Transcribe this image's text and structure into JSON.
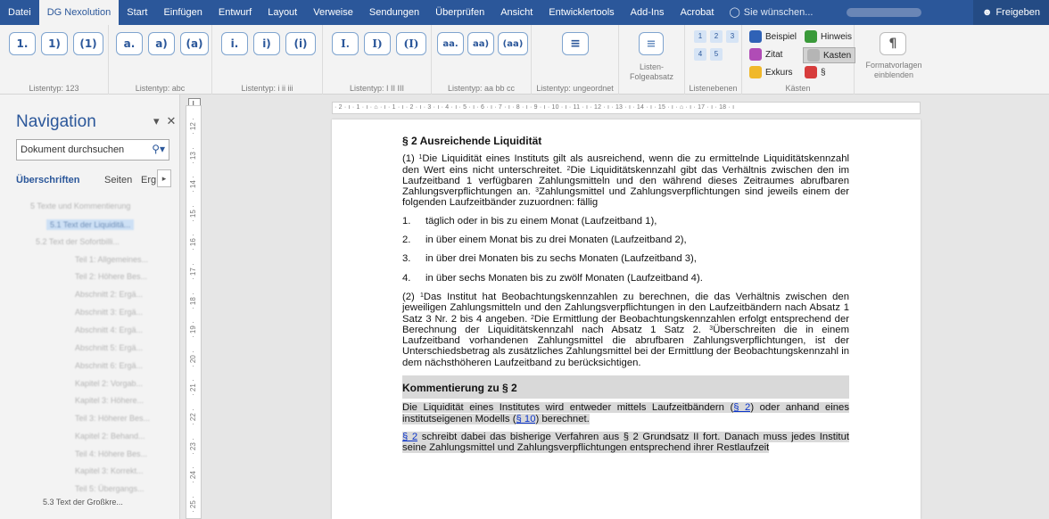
{
  "tabs": [
    "Datei",
    "DG Nexolution",
    "Start",
    "Einfügen",
    "Entwurf",
    "Layout",
    "Verweise",
    "Sendungen",
    "Überprüfen",
    "Ansicht",
    "Entwicklertools",
    "Add-Ins",
    "Acrobat"
  ],
  "tell_me": "Sie wünschen...",
  "share_label": "Freigeben",
  "ribbon": {
    "group_labels": [
      "Listentyp: 123",
      "Listentyp: abc",
      "Listentyp: i ii iii",
      "Listentyp: I II III",
      "Listentyp: aa bb cc",
      "Listentyp: ungeordnet",
      "Listen-\nFolgeabsatz",
      "Listenebenen",
      "Kästen",
      "Formatvorlagen\neinblenden"
    ],
    "btn_123": [
      "1.",
      "1)",
      "(1)"
    ],
    "btn_abc": [
      "a.",
      "a)",
      "(a)"
    ],
    "btn_roman_lower": [
      "i.",
      "i)",
      "(i)"
    ],
    "btn_roman_upper": [
      "I.",
      "I)",
      "(I)"
    ],
    "btn_aa": [
      "aa.",
      "aa)",
      "(aa)"
    ],
    "levels": [
      "1",
      "2",
      "3",
      "4",
      "5"
    ],
    "kasten": [
      "Beispiel",
      "Hinweis",
      "Zitat",
      "Kasten",
      "Exkurs",
      "§"
    ]
  },
  "nav": {
    "title": "Navigation",
    "search_placeholder": "Dokument durchsuchen",
    "tabs": [
      "Überschriften",
      "Seiten",
      "Erg"
    ],
    "items": [
      "5 Texte und Kommentierung",
      "5.1 Text der Liquiditä...",
      "5.2 Text der Sofortbilli...",
      "Teil 1: Allgemeines...",
      "Teil 2: Höhere Bes...",
      "Abschnitt 2: Ergä...",
      "Abschnitt 3: Ergä...",
      "Abschnitt 4: Ergä...",
      "Abschnitt 5: Ergä...",
      "Abschnitt 6: Ergä...",
      "Kapitel 2: Vorgab...",
      "Kapitel 3: Höhere...",
      "Teil 3: Höherer Bes...",
      "Kapitel 2: Behand...",
      "Teil 4: Höhere Bes...",
      "Kapitel 3: Korrekt...",
      "Teil 5: Übergangs..."
    ],
    "last_item": "5.3 Text der Großkre..."
  },
  "hruler": "· 2 · ı · 1 · ı · ⌂ · ı · 1 · ı · 2 · ı · 3 · ı · 4 · ı · 5 · ı · 6 · ı · 7 · ı · 8 · ı · 9 · ı · 10 · ı · 11 · ı · 12 · ı · 13 · ı · 14 · ı · 15 · ı · ⌂ · ı · 17 · ı · 18 · ı",
  "vruler": [
    "12",
    "13",
    "14",
    "15",
    "16",
    "17",
    "18",
    "19",
    "20",
    "21",
    "22",
    "23",
    "24",
    "25"
  ],
  "document": {
    "heading": "§ 2 Ausreichende Liquidität",
    "p1_a": "(1) ",
    "p1_b": "Die Liquidität eines Instituts gilt als ausreichend, wenn die zu ermittelnde Liquiditätskennzahl den Wert eins nicht unterschreitet. ",
    "p1_c": "Die Liquiditätskennzahl gibt das Verhältnis zwischen den im Laufzeitband 1 verfügbaren Zahlungsmitteln und den während dieses Zeitraumes abrufbaren Zahlungsverpflichtungen an. ",
    "p1_d": "Zahlungsmittel und Zahlungsverpflichtungen sind jeweils einem der folgenden Laufzeitbänder zuzuordnen: fällig",
    "list": [
      {
        "num": "1.",
        "text": "täglich oder in bis zu einem Monat (Laufzeitband 1),"
      },
      {
        "num": "2.",
        "text": "in über einem Monat bis zu drei Monaten (Laufzeitband 2),"
      },
      {
        "num": "3.",
        "text": "in über drei Monaten bis zu sechs Monaten (Laufzeitband 3),"
      },
      {
        "num": "4.",
        "text": "in über sechs Monaten bis zu zwölf Monaten (Laufzeitband 4)."
      }
    ],
    "p2_a": "(2) ",
    "p2_b": "Das Institut hat Beobachtungskennzahlen zu berechnen, die das Verhältnis zwischen den jeweiligen Zahlungsmitteln und den Zahlungsverpflichtungen in den Laufzeitbändern nach Absatz 1 Satz 3 Nr. 2 bis 4 angeben. ",
    "p2_c": "Die Ermittlung der Beobachtungskennzahlen erfolgt entsprechend der Berechnung der Liquiditätskennzahl nach Absatz 1 Satz 2. ",
    "p2_d": "Überschreiten die in einem Laufzeitband vorhandenen Zahlungsmittel die abrufbaren Zahlungsverpflichtungen, ist der Unterschiedsbetrag als zusätzliches Zahlungsmittel bei der Ermittlung der Beobachtungskennzahl in dem nächsthöheren Laufzeitband zu berücksichtigen.",
    "sup1": "1",
    "sup2": "2",
    "sup3": "3",
    "comm_title": "Kommentierung zu § 2",
    "c1_a": "Die Liquidität eines Institutes wird entweder mittels Laufzeitbändern (",
    "c1_link1": "§ 2",
    "c1_b": ") oder anhand eines institutseigenen Modells (",
    "c1_link2": "§ 10",
    "c1_c": ") berechnet.",
    "c2_link": "§ 2",
    "c2_text": " schreibt dabei das bisherige Verfahren aus § 2 Grundsatz II fort. Danach muss jedes Institut seine Zahlungsmittel und Zahlungsverpflichtungen entsprechend ihrer Restlaufzeit"
  },
  "colors": {
    "accent": "#2b579a",
    "link": "#0b34c9",
    "comment_bg": "#d9d9d9"
  }
}
